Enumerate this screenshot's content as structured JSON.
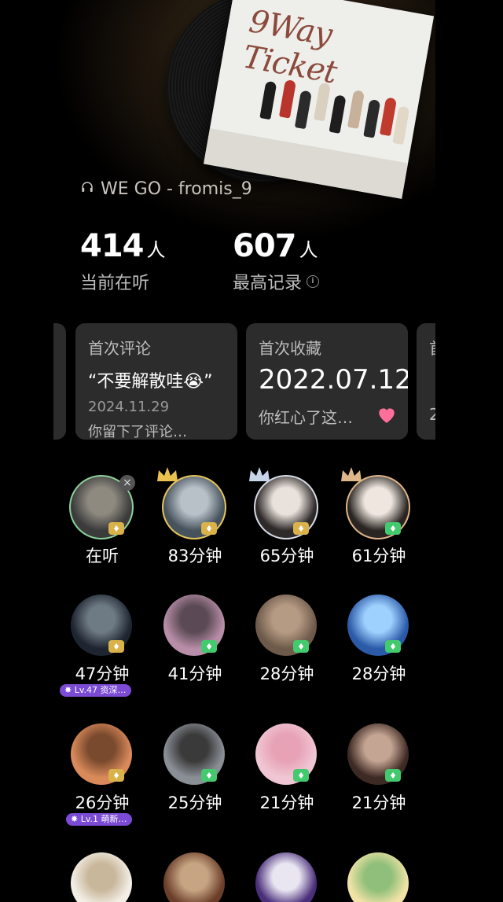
{
  "now_playing": {
    "icon": "headphones-icon",
    "text": "WE GO - fromis_9"
  },
  "album": {
    "title": "9Way Ticket"
  },
  "stats": [
    {
      "value": "414",
      "unit": "人",
      "label": "当前在听"
    },
    {
      "value": "607",
      "unit": "人",
      "label": "最高记录",
      "info_icon": "info-icon"
    }
  ],
  "cards": [
    {
      "title": "首次评论",
      "main": "“不要解散哇😭”",
      "date": "2024.11.29",
      "desc": "你留下了评论…"
    },
    {
      "title": "首次收藏",
      "main": "2022.07.12",
      "desc": "你红心了这…",
      "icon": "heart-icon"
    },
    {
      "title": "首",
      "main": "",
      "desc": "2"
    }
  ],
  "listeners": [
    {
      "minutes": "在听",
      "badge": "gold",
      "ring": "#8ad29a",
      "close": "×"
    },
    {
      "minutes": "83分钟",
      "badge": "gold",
      "crown": "gold",
      "ring": "#e6c65c"
    },
    {
      "minutes": "65分钟",
      "badge": "gold",
      "crown": "silver",
      "ring": "#d6dbe6"
    },
    {
      "minutes": "61分钟",
      "badge": "green",
      "crown": "bronze",
      "ring": "#e0b48a"
    },
    {
      "minutes": "47分钟",
      "badge": "gold",
      "level": "Lv.47 资深…"
    },
    {
      "minutes": "41分钟",
      "badge": "green"
    },
    {
      "minutes": "28分钟",
      "badge": "green"
    },
    {
      "minutes": "28分钟",
      "badge": "green"
    },
    {
      "minutes": "26分钟",
      "badge": "gold",
      "level": "Lv.1 萌新…"
    },
    {
      "minutes": "25分钟",
      "badge": "green"
    },
    {
      "minutes": "21分钟",
      "badge": "green"
    },
    {
      "minutes": "21分钟",
      "badge": "green"
    },
    {
      "minutes": "",
      "badge": ""
    },
    {
      "minutes": "",
      "badge": ""
    },
    {
      "minutes": "",
      "badge": ""
    },
    {
      "minutes": "",
      "badge": ""
    }
  ],
  "colors": {
    "background": "#000000",
    "card": "#2c2c2c",
    "level_badge": "#7b4bd6",
    "heart": "#ff6f9a"
  }
}
